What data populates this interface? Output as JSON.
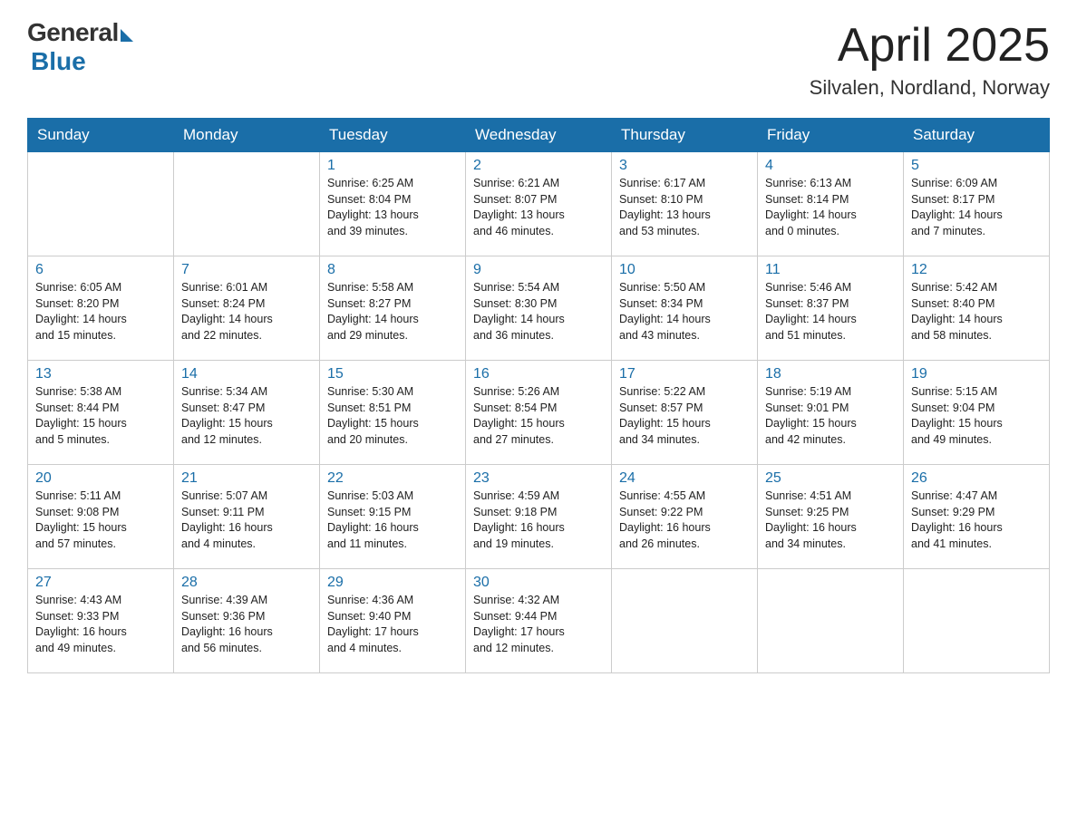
{
  "header": {
    "logo_general": "General",
    "logo_blue": "Blue",
    "month_title": "April 2025",
    "location": "Silvalen, Nordland, Norway"
  },
  "days_of_week": [
    "Sunday",
    "Monday",
    "Tuesday",
    "Wednesday",
    "Thursday",
    "Friday",
    "Saturday"
  ],
  "weeks": [
    [
      {
        "day": "",
        "info": ""
      },
      {
        "day": "",
        "info": ""
      },
      {
        "day": "1",
        "info": "Sunrise: 6:25 AM\nSunset: 8:04 PM\nDaylight: 13 hours\nand 39 minutes."
      },
      {
        "day": "2",
        "info": "Sunrise: 6:21 AM\nSunset: 8:07 PM\nDaylight: 13 hours\nand 46 minutes."
      },
      {
        "day": "3",
        "info": "Sunrise: 6:17 AM\nSunset: 8:10 PM\nDaylight: 13 hours\nand 53 minutes."
      },
      {
        "day": "4",
        "info": "Sunrise: 6:13 AM\nSunset: 8:14 PM\nDaylight: 14 hours\nand 0 minutes."
      },
      {
        "day": "5",
        "info": "Sunrise: 6:09 AM\nSunset: 8:17 PM\nDaylight: 14 hours\nand 7 minutes."
      }
    ],
    [
      {
        "day": "6",
        "info": "Sunrise: 6:05 AM\nSunset: 8:20 PM\nDaylight: 14 hours\nand 15 minutes."
      },
      {
        "day": "7",
        "info": "Sunrise: 6:01 AM\nSunset: 8:24 PM\nDaylight: 14 hours\nand 22 minutes."
      },
      {
        "day": "8",
        "info": "Sunrise: 5:58 AM\nSunset: 8:27 PM\nDaylight: 14 hours\nand 29 minutes."
      },
      {
        "day": "9",
        "info": "Sunrise: 5:54 AM\nSunset: 8:30 PM\nDaylight: 14 hours\nand 36 minutes."
      },
      {
        "day": "10",
        "info": "Sunrise: 5:50 AM\nSunset: 8:34 PM\nDaylight: 14 hours\nand 43 minutes."
      },
      {
        "day": "11",
        "info": "Sunrise: 5:46 AM\nSunset: 8:37 PM\nDaylight: 14 hours\nand 51 minutes."
      },
      {
        "day": "12",
        "info": "Sunrise: 5:42 AM\nSunset: 8:40 PM\nDaylight: 14 hours\nand 58 minutes."
      }
    ],
    [
      {
        "day": "13",
        "info": "Sunrise: 5:38 AM\nSunset: 8:44 PM\nDaylight: 15 hours\nand 5 minutes."
      },
      {
        "day": "14",
        "info": "Sunrise: 5:34 AM\nSunset: 8:47 PM\nDaylight: 15 hours\nand 12 minutes."
      },
      {
        "day": "15",
        "info": "Sunrise: 5:30 AM\nSunset: 8:51 PM\nDaylight: 15 hours\nand 20 minutes."
      },
      {
        "day": "16",
        "info": "Sunrise: 5:26 AM\nSunset: 8:54 PM\nDaylight: 15 hours\nand 27 minutes."
      },
      {
        "day": "17",
        "info": "Sunrise: 5:22 AM\nSunset: 8:57 PM\nDaylight: 15 hours\nand 34 minutes."
      },
      {
        "day": "18",
        "info": "Sunrise: 5:19 AM\nSunset: 9:01 PM\nDaylight: 15 hours\nand 42 minutes."
      },
      {
        "day": "19",
        "info": "Sunrise: 5:15 AM\nSunset: 9:04 PM\nDaylight: 15 hours\nand 49 minutes."
      }
    ],
    [
      {
        "day": "20",
        "info": "Sunrise: 5:11 AM\nSunset: 9:08 PM\nDaylight: 15 hours\nand 57 minutes."
      },
      {
        "day": "21",
        "info": "Sunrise: 5:07 AM\nSunset: 9:11 PM\nDaylight: 16 hours\nand 4 minutes."
      },
      {
        "day": "22",
        "info": "Sunrise: 5:03 AM\nSunset: 9:15 PM\nDaylight: 16 hours\nand 11 minutes."
      },
      {
        "day": "23",
        "info": "Sunrise: 4:59 AM\nSunset: 9:18 PM\nDaylight: 16 hours\nand 19 minutes."
      },
      {
        "day": "24",
        "info": "Sunrise: 4:55 AM\nSunset: 9:22 PM\nDaylight: 16 hours\nand 26 minutes."
      },
      {
        "day": "25",
        "info": "Sunrise: 4:51 AM\nSunset: 9:25 PM\nDaylight: 16 hours\nand 34 minutes."
      },
      {
        "day": "26",
        "info": "Sunrise: 4:47 AM\nSunset: 9:29 PM\nDaylight: 16 hours\nand 41 minutes."
      }
    ],
    [
      {
        "day": "27",
        "info": "Sunrise: 4:43 AM\nSunset: 9:33 PM\nDaylight: 16 hours\nand 49 minutes."
      },
      {
        "day": "28",
        "info": "Sunrise: 4:39 AM\nSunset: 9:36 PM\nDaylight: 16 hours\nand 56 minutes."
      },
      {
        "day": "29",
        "info": "Sunrise: 4:36 AM\nSunset: 9:40 PM\nDaylight: 17 hours\nand 4 minutes."
      },
      {
        "day": "30",
        "info": "Sunrise: 4:32 AM\nSunset: 9:44 PM\nDaylight: 17 hours\nand 12 minutes."
      },
      {
        "day": "",
        "info": ""
      },
      {
        "day": "",
        "info": ""
      },
      {
        "day": "",
        "info": ""
      }
    ]
  ]
}
